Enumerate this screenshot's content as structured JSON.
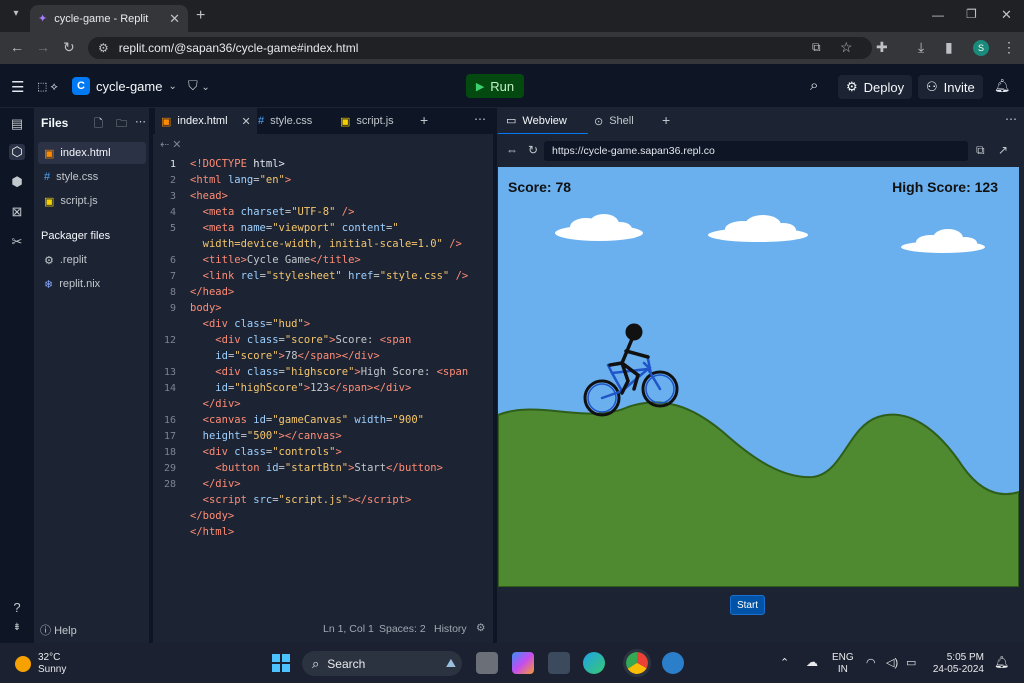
{
  "browser": {
    "tab_title": "cycle-game - Replit",
    "url": "replit.com/@sapan36/cycle-game#index.html"
  },
  "replit": {
    "project_name": "cycle-game",
    "run_label": "Run",
    "deploy_label": "Deploy",
    "invite_label": "Invite",
    "help_label": "Help"
  },
  "files": {
    "heading": "Files",
    "items": [
      "index.html",
      "style.css",
      "script.js"
    ],
    "packager_heading": "Packager files",
    "packager_items": [
      ".replit",
      "replit.nix"
    ]
  },
  "editor": {
    "tabs": [
      "index.html",
      "style.css",
      "script.js"
    ],
    "line_numbers": [
      "1",
      "2",
      "3",
      "4",
      "5",
      "",
      "6",
      "7",
      "8",
      "9",
      "",
      "12",
      "",
      "13",
      "14",
      "",
      "16",
      "17",
      "18",
      "29",
      "28"
    ],
    "status": {
      "position": "Ln 1, Col 1",
      "spaces": "Spaces: 2",
      "history": "History"
    }
  },
  "preview": {
    "tabs": [
      "Webview",
      "Shell"
    ],
    "url": "https://cycle-game.sapan36.repl.co",
    "score": "Score: 78",
    "high_score": "High Score: 123",
    "start_label": "Start"
  },
  "taskbar": {
    "temperature": "32°C",
    "weather": "Sunny",
    "search_label": "Search",
    "lang": "ENG",
    "region": "IN",
    "time": "5:05 PM",
    "date": "24-05-2024"
  },
  "colors": {
    "accent": "#0079f2",
    "run_green": "#044a10",
    "sky": "#6ab0ef",
    "ground": "#4f8a30"
  }
}
